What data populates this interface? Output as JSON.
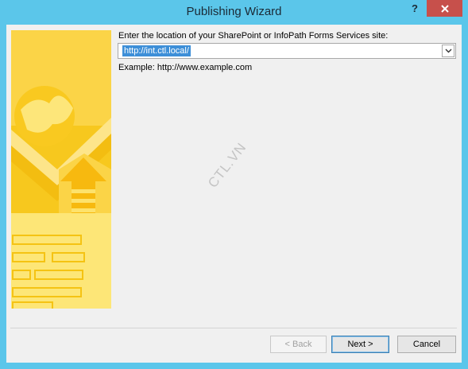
{
  "window": {
    "title": "Publishing Wizard",
    "help_label": "?",
    "close_icon": "close-icon"
  },
  "form": {
    "prompt": "Enter the location of your SharePoint or InfoPath Forms Services site:",
    "location_value": "http://int.ctl.local/",
    "example": "Example: http://www.example.com"
  },
  "watermark": "CTL.VN",
  "buttons": {
    "back": "< Back",
    "next": "Next >",
    "cancel": "Cancel"
  },
  "colors": {
    "accent": "#5bc6ea",
    "close": "#c7504b",
    "art_yellow": "#f7c81e",
    "selection": "#3d8fd8"
  }
}
